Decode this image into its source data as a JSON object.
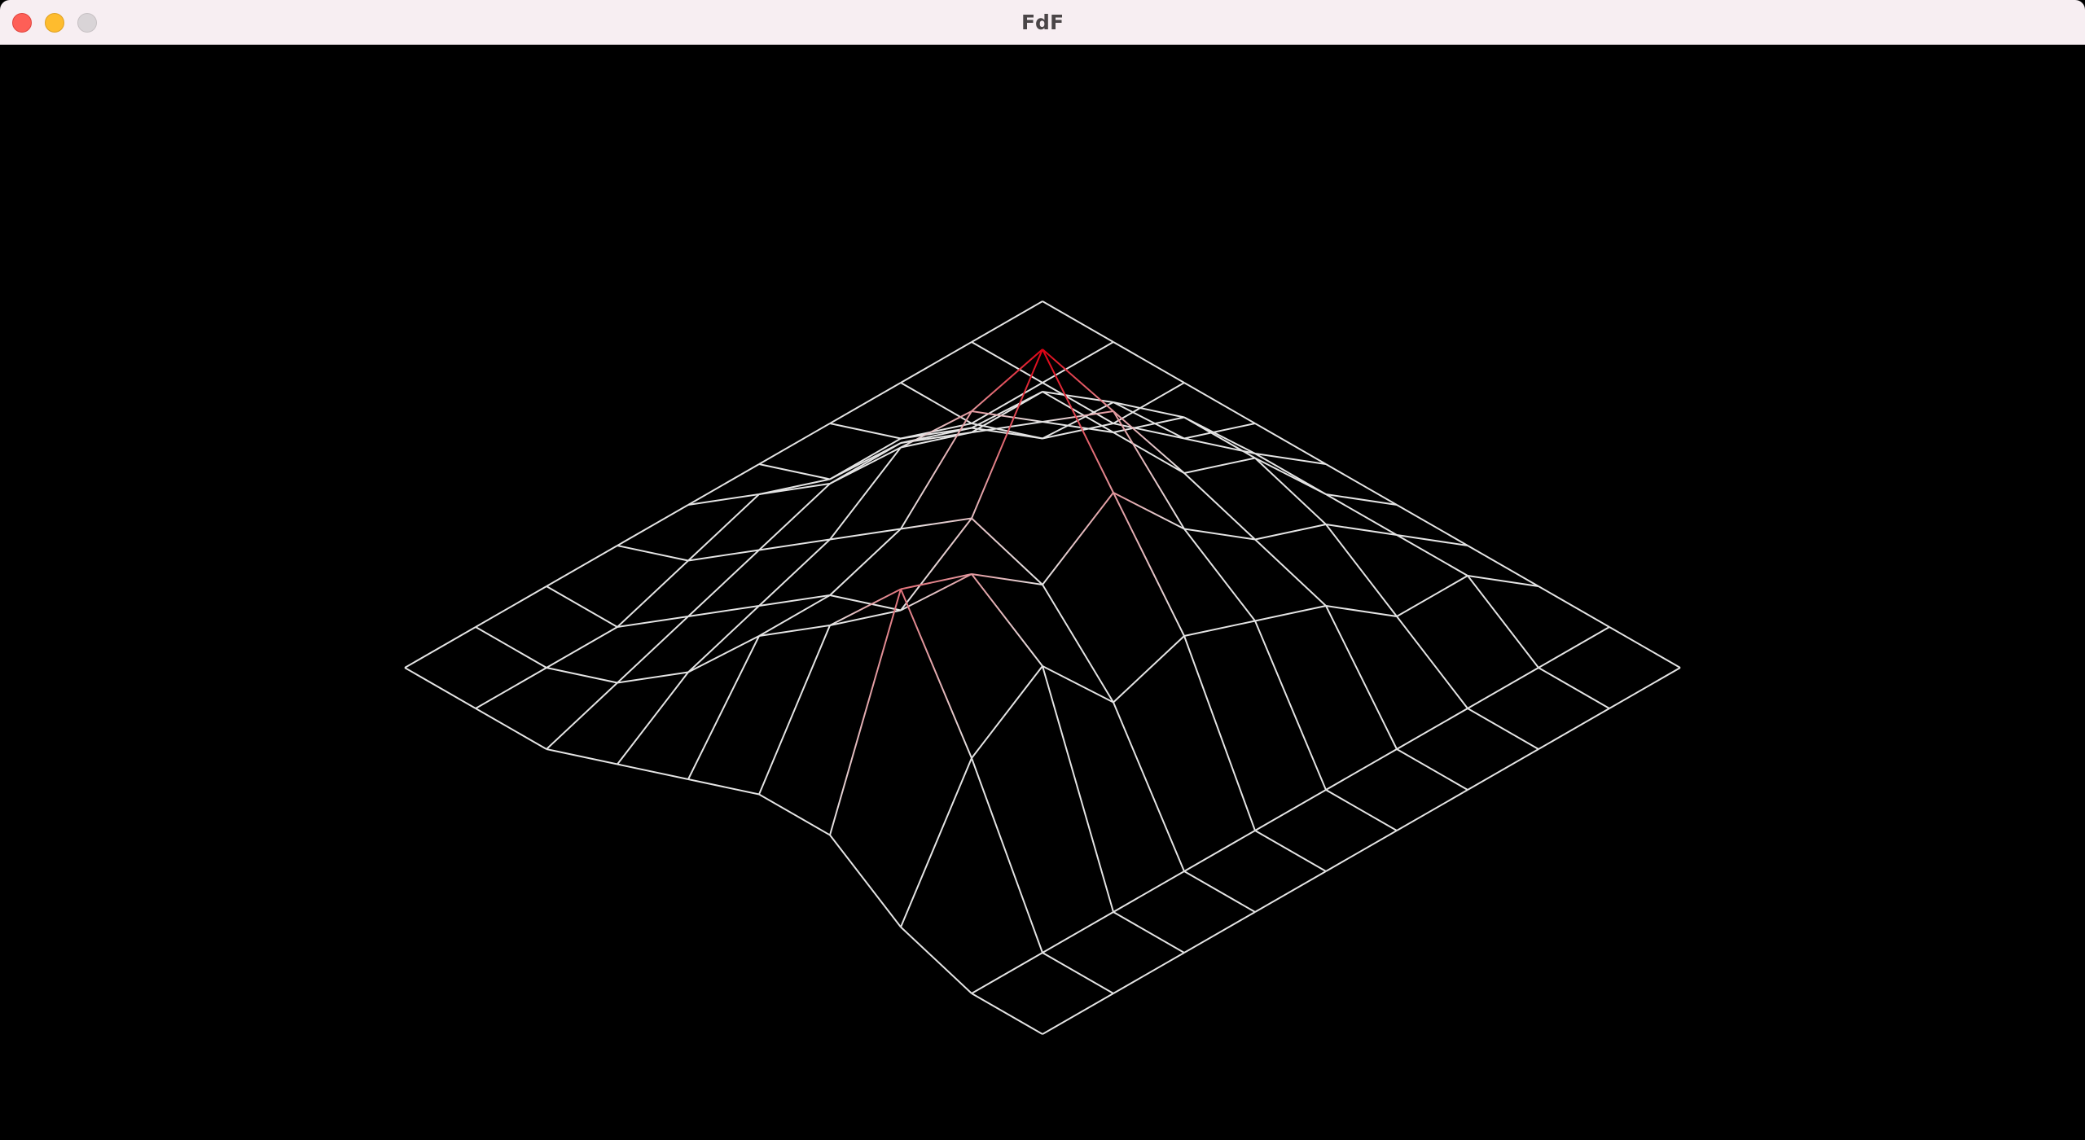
{
  "window": {
    "title": "FdF"
  },
  "controls": {
    "close_icon": "close-icon",
    "minimize_icon": "minimize-icon",
    "zoom_icon": "zoom-icon"
  },
  "colors": {
    "background": "#000000",
    "low": "#e4e4e4",
    "high": "#e00012",
    "titlebar": "#f7eef2"
  },
  "map": {
    "heights": [
      [
        0,
        0,
        0,
        0,
        0,
        0,
        0,
        0,
        0,
        0
      ],
      [
        0,
        0,
        0,
        1,
        2,
        2,
        2,
        2,
        0,
        0
      ],
      [
        0,
        0,
        1,
        4,
        5,
        5,
        4,
        2,
        0,
        0
      ],
      [
        0,
        1,
        3,
        6,
        6,
        6,
        5,
        4,
        0,
        0
      ],
      [
        0,
        1,
        4,
        6,
        8,
        10,
        7,
        5,
        0,
        0
      ],
      [
        0,
        2,
        4,
        7,
        10,
        14,
        10,
        6,
        0,
        0
      ],
      [
        0,
        1,
        3,
        5,
        7,
        9,
        8,
        5,
        0,
        0
      ],
      [
        0,
        0,
        2,
        4,
        6,
        7,
        10,
        8,
        0,
        0
      ],
      [
        0,
        0,
        1,
        3,
        6,
        8,
        11,
        6,
        0,
        0
      ],
      [
        0,
        0,
        0,
        1,
        2,
        3,
        3,
        1,
        0,
        0
      ]
    ]
  }
}
